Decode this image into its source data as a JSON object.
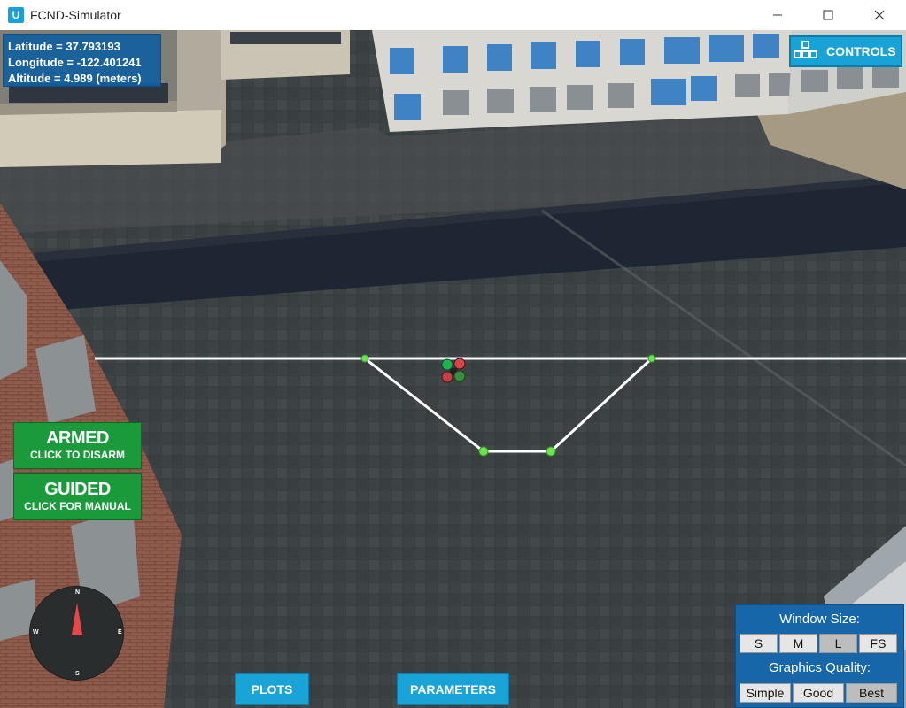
{
  "window": {
    "title": "FCND-Simulator",
    "icon": "unity-icon"
  },
  "info": {
    "latitude": "Latitude = 37.793193",
    "longitude": "Longitude = -122.401241",
    "altitude": "Altitude = 4.989 (meters)"
  },
  "controls": {
    "label": "CONTROLS",
    "icon": "controls-icon"
  },
  "armed": {
    "title": "ARMED",
    "subtitle": "CLICK TO DISARM"
  },
  "guided": {
    "title": "GUIDED",
    "subtitle": "CLICK FOR MANUAL"
  },
  "compass": {
    "n": "N",
    "s": "S",
    "e": "E",
    "w": "W"
  },
  "bottom": {
    "plots": "PLOTS",
    "parameters": "PARAMETERS"
  },
  "settings": {
    "window_size_label": "Window Size:",
    "sizes": [
      "S",
      "M",
      "L",
      "FS"
    ],
    "selected_size": "L",
    "quality_label": "Graphics Quality:",
    "qualities": [
      "Simple",
      "Good",
      "Best"
    ],
    "selected_quality": "Best"
  },
  "colors": {
    "accent": "#1aa3d6",
    "armed_green": "#1b9a3b",
    "panel_blue": "#1666a9",
    "waypoint_green": "#6be34a"
  }
}
